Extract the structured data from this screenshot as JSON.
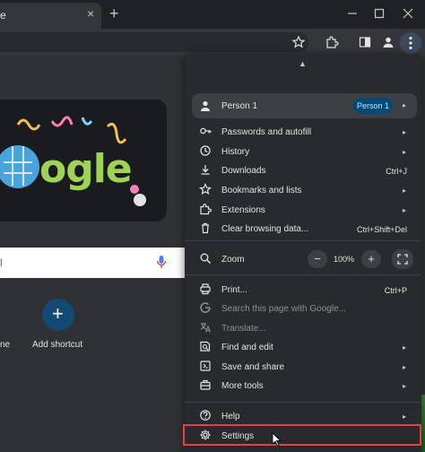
{
  "tab": {
    "title": "e",
    "close": "×",
    "new_tab": "+"
  },
  "window": {
    "minimize": "minimize-icon",
    "maximize": "maximize-icon",
    "close": "close-icon"
  },
  "page": {
    "search_placeholder": "l",
    "shortcut_label": "Add shortcut",
    "ne_label": "ne",
    "doodle_text": "ogle"
  },
  "menu": {
    "profile": {
      "name": "Person 1",
      "badge": "Person 1"
    },
    "items_group1": [
      {
        "label": "Passwords and autofill",
        "arrow": "▸",
        "icon": "key-icon"
      },
      {
        "label": "History",
        "arrow": "▸",
        "icon": "history-icon"
      },
      {
        "label": "Downloads",
        "shortcut": "Ctrl+J",
        "icon": "download-icon"
      },
      {
        "label": "Bookmarks and lists",
        "arrow": "▸",
        "icon": "star-icon"
      },
      {
        "label": "Extensions",
        "arrow": "▸",
        "icon": "puzzle-icon"
      },
      {
        "label": "Clear browsing data...",
        "shortcut": "Ctrl+Shift+Del",
        "icon": "trash-icon"
      }
    ],
    "zoom": {
      "label": "Zoom",
      "value": "100%",
      "minus": "−",
      "plus": "+"
    },
    "items_group2": [
      {
        "label": "Print...",
        "shortcut": "Ctrl+P",
        "icon": "print-icon"
      },
      {
        "label": "Search this page with Google...",
        "icon": "google-icon",
        "disabled": true
      },
      {
        "label": "Translate...",
        "icon": "translate-icon",
        "disabled": true
      },
      {
        "label": "Find and edit",
        "arrow": "▸",
        "icon": "find-icon"
      },
      {
        "label": "Save and share",
        "arrow": "▸",
        "icon": "save-icon"
      },
      {
        "label": "More tools",
        "arrow": "▸",
        "icon": "toolbox-icon"
      }
    ],
    "items_group3": [
      {
        "label": "Help",
        "arrow": "▸",
        "icon": "help-icon"
      },
      {
        "label": "Settings",
        "icon": "gear-icon"
      }
    ]
  },
  "colors": {
    "highlight": "#e8413f",
    "accent": "#004a77"
  }
}
